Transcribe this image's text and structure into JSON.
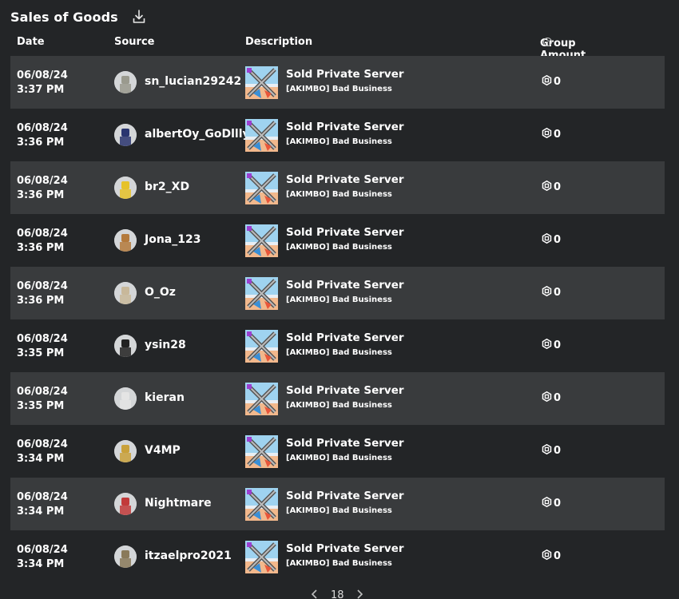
{
  "title": "Sales of Goods",
  "columns": {
    "date": "Date",
    "source": "Source",
    "description": "Description",
    "amount": "Group Amount",
    "amount_help": "?"
  },
  "rows": [
    {
      "date": "06/08/24",
      "time": "3:37 PM",
      "user": "sn_lucian29242",
      "avatar": "#9a9a8e",
      "item": "Sold Private Server",
      "game": "[AKIMBO] Bad Business",
      "amount": "0"
    },
    {
      "date": "06/08/24",
      "time": "3:36 PM",
      "user": "albertOy_GoDllly",
      "avatar": "#2a3570",
      "item": "Sold Private Server",
      "game": "[AKIMBO] Bad Business",
      "amount": "0"
    },
    {
      "date": "06/08/24",
      "time": "3:36 PM",
      "user": "br2_XD",
      "avatar": "#e6c22a",
      "item": "Sold Private Server",
      "game": "[AKIMBO] Bad Business",
      "amount": "0"
    },
    {
      "date": "06/08/24",
      "time": "3:36 PM",
      "user": "Jona_123",
      "avatar": "#b47a3c",
      "item": "Sold Private Server",
      "game": "[AKIMBO] Bad Business",
      "amount": "0"
    },
    {
      "date": "06/08/24",
      "time": "3:36 PM",
      "user": "O_Oz",
      "avatar": "#c8b89a",
      "item": "Sold Private Server",
      "game": "[AKIMBO] Bad Business",
      "amount": "0"
    },
    {
      "date": "06/08/24",
      "time": "3:35 PM",
      "user": "ysin28",
      "avatar": "#222222",
      "item": "Sold Private Server",
      "game": "[AKIMBO] Bad Business",
      "amount": "0"
    },
    {
      "date": "06/08/24",
      "time": "3:35 PM",
      "user": "kieran",
      "avatar": "#e4e4e4",
      "item": "Sold Private Server",
      "game": "[AKIMBO] Bad Business",
      "amount": "0"
    },
    {
      "date": "06/08/24",
      "time": "3:34 PM",
      "user": "V4MP",
      "avatar": "#c9a13b",
      "item": "Sold Private Server",
      "game": "[AKIMBO] Bad Business",
      "amount": "0"
    },
    {
      "date": "06/08/24",
      "time": "3:34 PM",
      "user": "Nightmare",
      "avatar": "#c23a3a",
      "item": "Sold Private Server",
      "game": "[AKIMBO] Bad Business",
      "amount": "0"
    },
    {
      "date": "06/08/24",
      "time": "3:34 PM",
      "user": "itzaelpro2021",
      "avatar": "#8a7a5a",
      "item": "Sold Private Server",
      "game": "[AKIMBO] Bad Business",
      "amount": "0"
    }
  ],
  "pager": {
    "page": "18"
  },
  "colors": {
    "background": "#232527",
    "row_alt": "#393b3d",
    "text": "#ffffff"
  }
}
